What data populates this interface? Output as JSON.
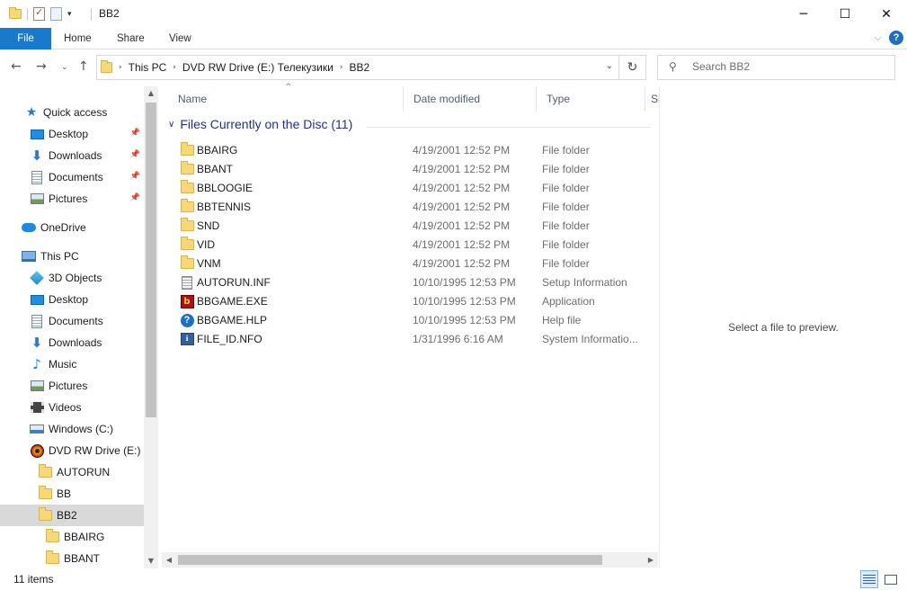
{
  "window": {
    "title": "BB2",
    "minimize": "─",
    "maximize": "☐",
    "close": "✕"
  },
  "ribbon": {
    "tabs": [
      "File",
      "Home",
      "Share",
      "View"
    ]
  },
  "address": {
    "crumbs": [
      "This PC",
      "DVD RW Drive (E:) Телекузики",
      "BB2"
    ],
    "search_placeholder": "Search BB2"
  },
  "nav": {
    "items": [
      {
        "label": "Quick access",
        "icon": "star-icon"
      },
      {
        "label": "Desktop",
        "icon": "desktop-icon",
        "pinned": true
      },
      {
        "label": "Downloads",
        "icon": "download-icon",
        "pinned": true
      },
      {
        "label": "Documents",
        "icon": "document-icon",
        "pinned": true
      },
      {
        "label": "Pictures",
        "icon": "pictures-icon",
        "pinned": true
      },
      {
        "label": "OneDrive",
        "icon": "cloud-icon"
      },
      {
        "label": "This PC",
        "icon": "computer-icon"
      },
      {
        "label": "3D Objects",
        "icon": "cube-icon"
      },
      {
        "label": "Desktop",
        "icon": "desktop-icon"
      },
      {
        "label": "Documents",
        "icon": "document-icon"
      },
      {
        "label": "Downloads",
        "icon": "download-icon"
      },
      {
        "label": "Music",
        "icon": "music-icon"
      },
      {
        "label": "Pictures",
        "icon": "pictures-icon"
      },
      {
        "label": "Videos",
        "icon": "video-icon"
      },
      {
        "label": "Windows (C:)",
        "icon": "drive-icon"
      },
      {
        "label": "DVD RW Drive (E:) Телекузики",
        "icon": "dvd-icon"
      },
      {
        "label": "AUTORUN",
        "icon": "folder-icon"
      },
      {
        "label": "BB",
        "icon": "folder-icon"
      },
      {
        "label": "BB2",
        "icon": "folder-icon",
        "selected": true
      },
      {
        "label": "BBAIRG",
        "icon": "folder-icon"
      },
      {
        "label": "BBANT",
        "icon": "folder-icon"
      }
    ]
  },
  "columns": {
    "name": "Name",
    "date": "Date modified",
    "type": "Type",
    "size": "Si"
  },
  "group": {
    "title": "Files Currently on the Disc (11)"
  },
  "files": [
    {
      "name": "BBAIRG",
      "date": "4/19/2001 12:52 PM",
      "type": "File folder",
      "icon": "folder-icon"
    },
    {
      "name": "BBANT",
      "date": "4/19/2001 12:52 PM",
      "type": "File folder",
      "icon": "folder-icon"
    },
    {
      "name": "BBLOOGIE",
      "date": "4/19/2001 12:52 PM",
      "type": "File folder",
      "icon": "folder-icon"
    },
    {
      "name": "BBTENNIS",
      "date": "4/19/2001 12:52 PM",
      "type": "File folder",
      "icon": "folder-icon"
    },
    {
      "name": "SND",
      "date": "4/19/2001 12:52 PM",
      "type": "File folder",
      "icon": "folder-icon"
    },
    {
      "name": "VID",
      "date": "4/19/2001 12:52 PM",
      "type": "File folder",
      "icon": "folder-icon"
    },
    {
      "name": "VNM",
      "date": "4/19/2001 12:52 PM",
      "type": "File folder",
      "icon": "folder-icon"
    },
    {
      "name": "AUTORUN.INF",
      "date": "10/10/1995 12:53 PM",
      "type": "Setup Information",
      "icon": "setup-file-icon"
    },
    {
      "name": "BBGAME.EXE",
      "date": "10/10/1995 12:53 PM",
      "type": "Application",
      "icon": "application-icon"
    },
    {
      "name": "BBGAME.HLP",
      "date": "10/10/1995 12:53 PM",
      "type": "Help file",
      "icon": "help-file-icon"
    },
    {
      "name": "FILE_ID.NFO",
      "date": "1/31/1996 6:16 AM",
      "type": "System Informatio...",
      "icon": "system-info-icon"
    }
  ],
  "preview": {
    "message": "Select a file to preview."
  },
  "status": {
    "item_count": "11 items"
  }
}
